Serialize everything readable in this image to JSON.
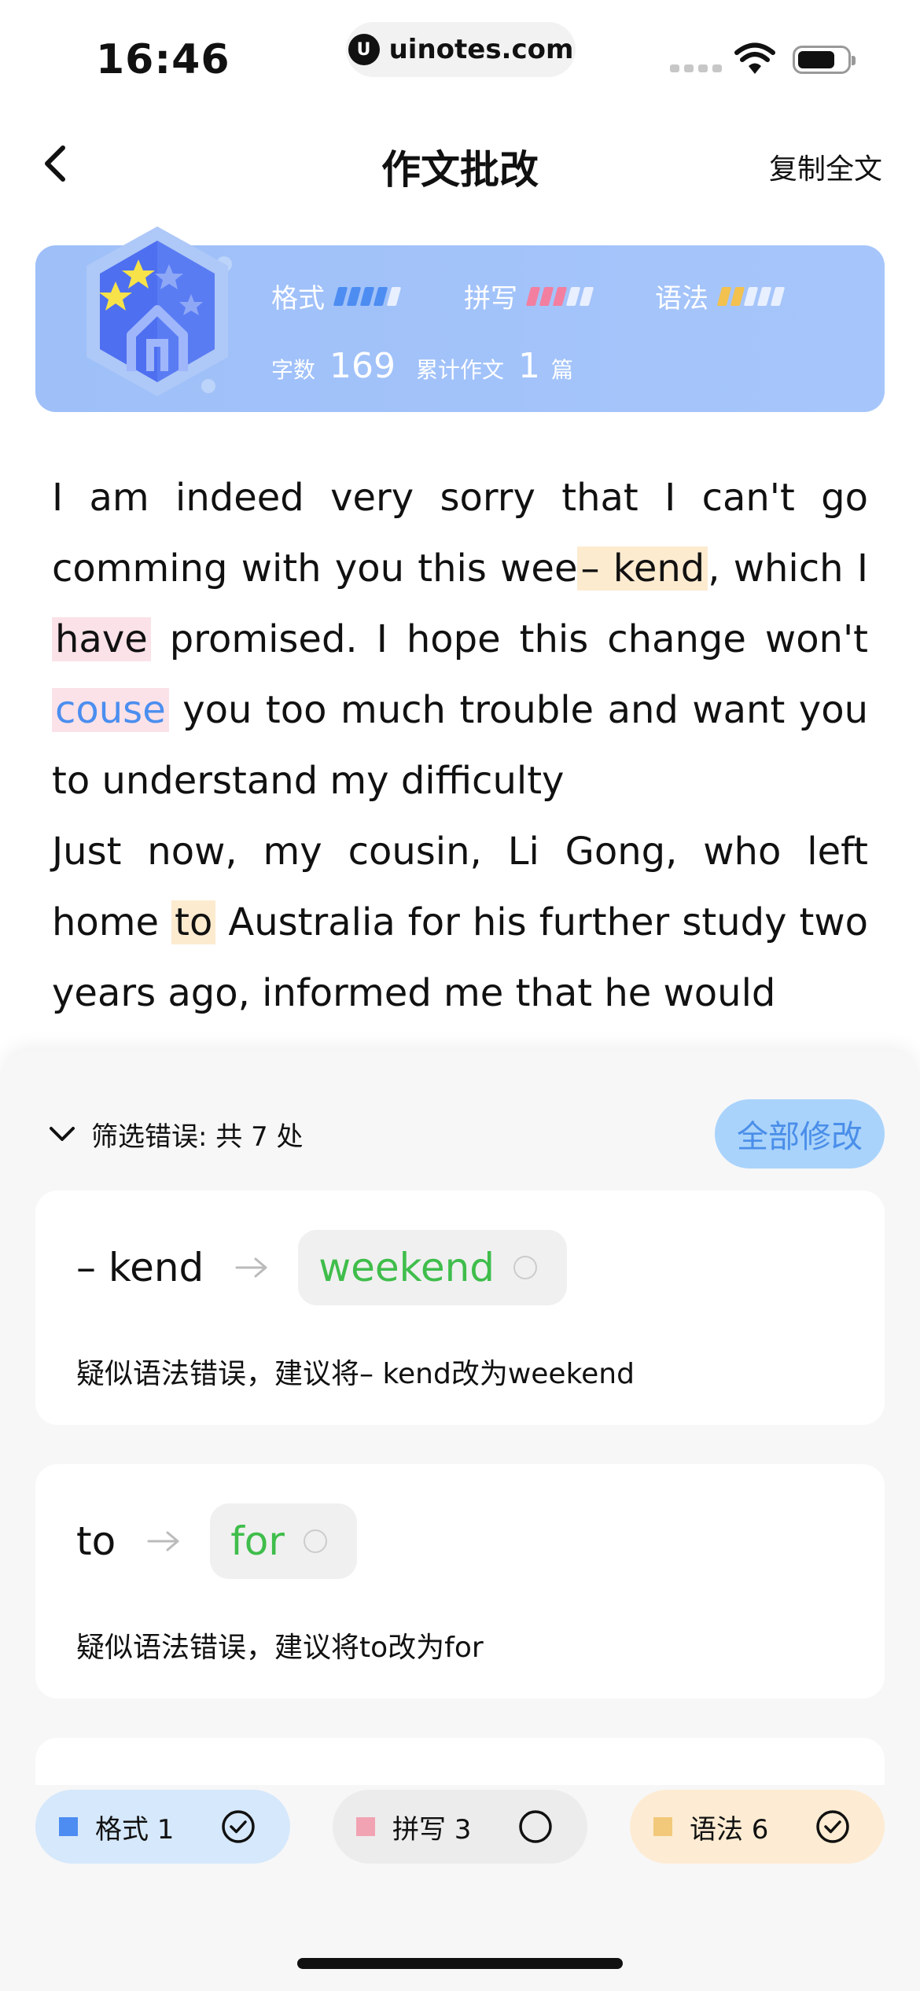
{
  "status_bar": {
    "time": "16:46",
    "url": "uinotes.com"
  },
  "header": {
    "title": "作文批改",
    "copy_label": "复制全文"
  },
  "stats": {
    "format_label": "格式",
    "spelling_label": "拼写",
    "grammar_label": "语法",
    "word_count_label": "字数",
    "word_count": "169",
    "total_label": "累计作文",
    "total_count": "1",
    "total_unit": "篇",
    "colors": {
      "format": "#4d8df2",
      "spelling": "#f27fa0",
      "grammar": "#f2c14f"
    }
  },
  "essay": {
    "p1": {
      "t1": "I am indeed very sorry that I can't go comming with you this wee",
      "h1": "– kend",
      "t2": ", which I ",
      "h2": "have",
      "t3": " promised. I hope this change won't ",
      "h3": "couse",
      "t4": " you too much trouble and want you to understand my difficulty"
    },
    "p2": {
      "t1": "Just now, my cousin, Li Gong, who left home ",
      "h1": "to",
      "t2": " Australia for his further study two years ago, informed me that he would"
    }
  },
  "sheet": {
    "filter_label": "筛选错误: 共 7 处",
    "fix_all_label": "全部修改",
    "errors": [
      {
        "original": "– kend",
        "suggestion": "weekend",
        "description": "疑似语法错误，建议将– kend改为weekend"
      },
      {
        "original": "to",
        "suggestion": "for",
        "description": "疑似语法错误，建议将to改为for"
      }
    ]
  },
  "chips": [
    {
      "label": "格式 1",
      "color": "#4d8df2",
      "checked": true
    },
    {
      "label": "拼写 3",
      "color": "#f2a3b3",
      "checked": false
    },
    {
      "label": "语法 6",
      "color": "#f2c97a",
      "checked": true
    }
  ]
}
